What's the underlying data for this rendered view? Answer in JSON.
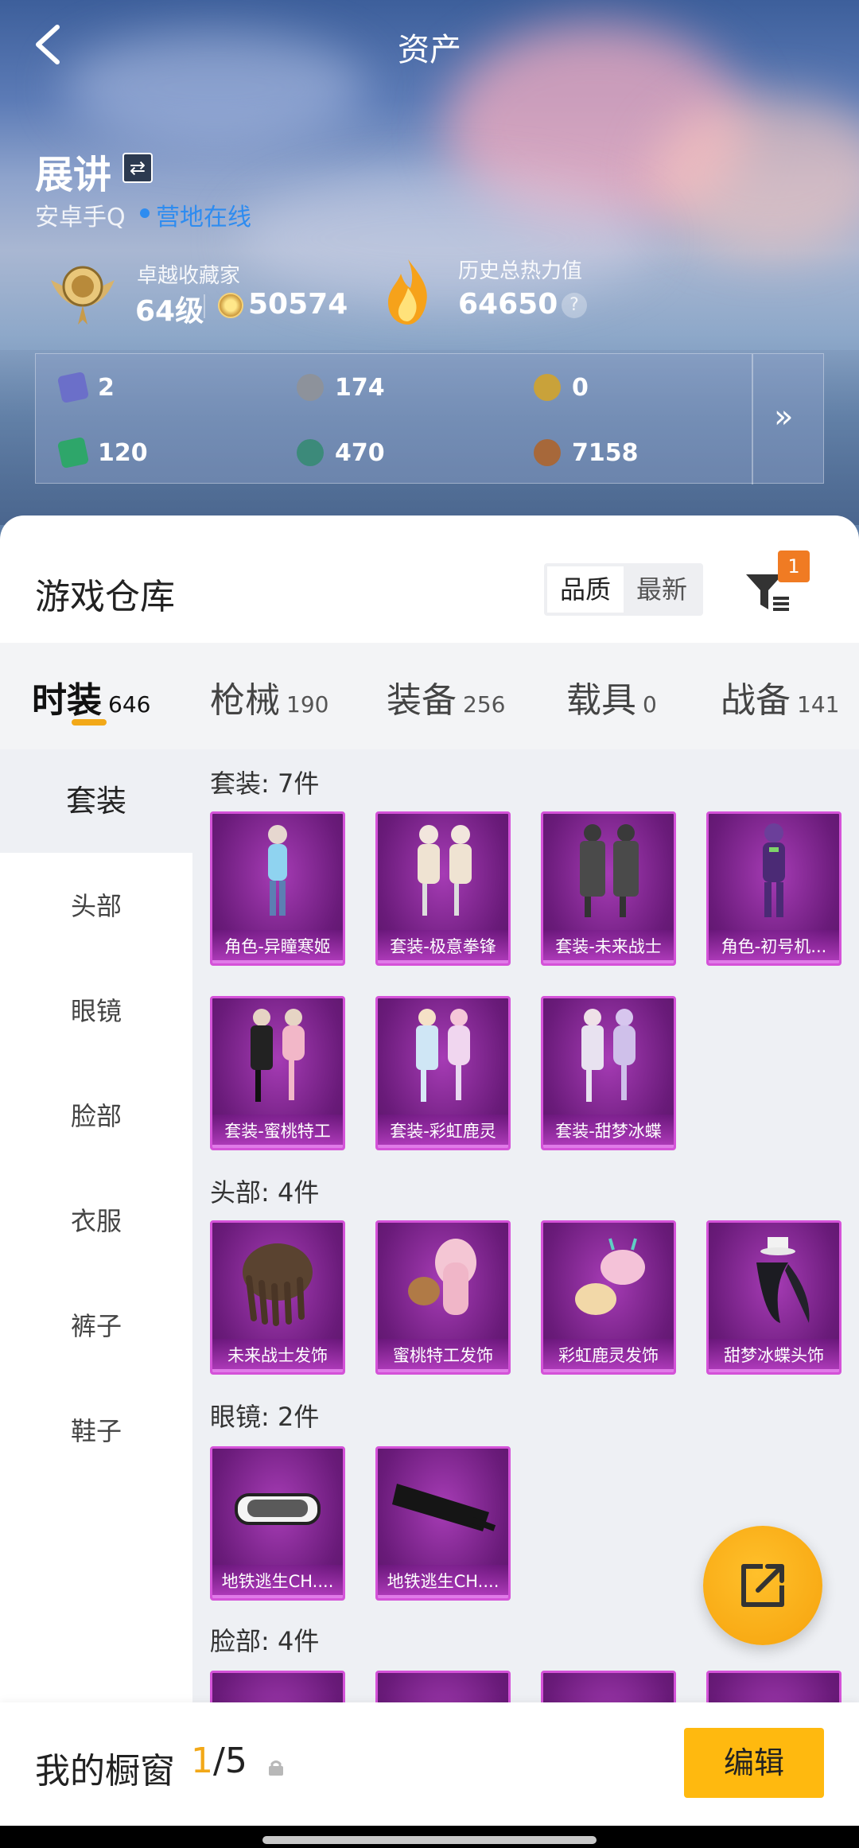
{
  "header": {
    "title": "资产"
  },
  "player": {
    "name": "展讲",
    "platform": "安卓手Q",
    "status": "营地在线",
    "collector_title": "卓越收藏家",
    "level": "64级",
    "coins": "50574",
    "heat_title": "历史总热力值",
    "heat_value": "64650",
    "help": "?"
  },
  "currencies": [
    {
      "icon": "purple-card-icon",
      "value": "2",
      "color": "#6b6fc9"
    },
    {
      "icon": "silver-coin-icon",
      "value": "174",
      "color": "#8d929b"
    },
    {
      "icon": "gold-medal-icon",
      "value": "0",
      "color": "#c9a23a"
    },
    {
      "icon": "green-card-icon",
      "value": "120",
      "color": "#2ea66a"
    },
    {
      "icon": "green-orb-icon",
      "value": "470",
      "color": "#3c8a7a"
    },
    {
      "icon": "bronze-coin-icon",
      "value": "7158",
      "color": "#a7683a"
    }
  ],
  "warehouse": {
    "title": "游戏仓库",
    "sort": [
      "品质",
      "最新"
    ],
    "filter_badge": "1"
  },
  "tabs": [
    {
      "label": "时装",
      "count": "646"
    },
    {
      "label": "枪械",
      "count": "190"
    },
    {
      "label": "装备",
      "count": "256"
    },
    {
      "label": "载具",
      "count": "0"
    },
    {
      "label": "战备",
      "count": "141"
    }
  ],
  "sidebar": [
    "套装",
    "头部",
    "眼镜",
    "脸部",
    "衣服",
    "裤子",
    "鞋子"
  ],
  "sections": [
    {
      "title": "套装: 7件",
      "items": [
        "角色-异瞳寒姬",
        "套装-极意拳锋",
        "套装-未来战士",
        "角色-初号机...",
        "套装-蜜桃特工",
        "套装-彩虹鹿灵",
        "套装-甜梦冰蝶"
      ]
    },
    {
      "title": "头部: 4件",
      "items": [
        "未来战士发饰",
        "蜜桃特工发饰",
        "彩虹鹿灵发饰",
        "甜梦冰蝶头饰"
      ]
    },
    {
      "title": "眼镜: 2件",
      "items": [
        "地铁逃生CH....",
        "地铁逃生CH...."
      ]
    },
    {
      "title": "脸部: 4件",
      "items": [
        "",
        "",
        "",
        ""
      ]
    }
  ],
  "showcase": {
    "title": "我的橱窗",
    "current": "1",
    "total": "/5",
    "edit": "编辑"
  },
  "colors": {
    "accent": "#f2a818",
    "link": "#2e8cf0",
    "card": "#a63cb5",
    "card_border": "#d452d8"
  }
}
